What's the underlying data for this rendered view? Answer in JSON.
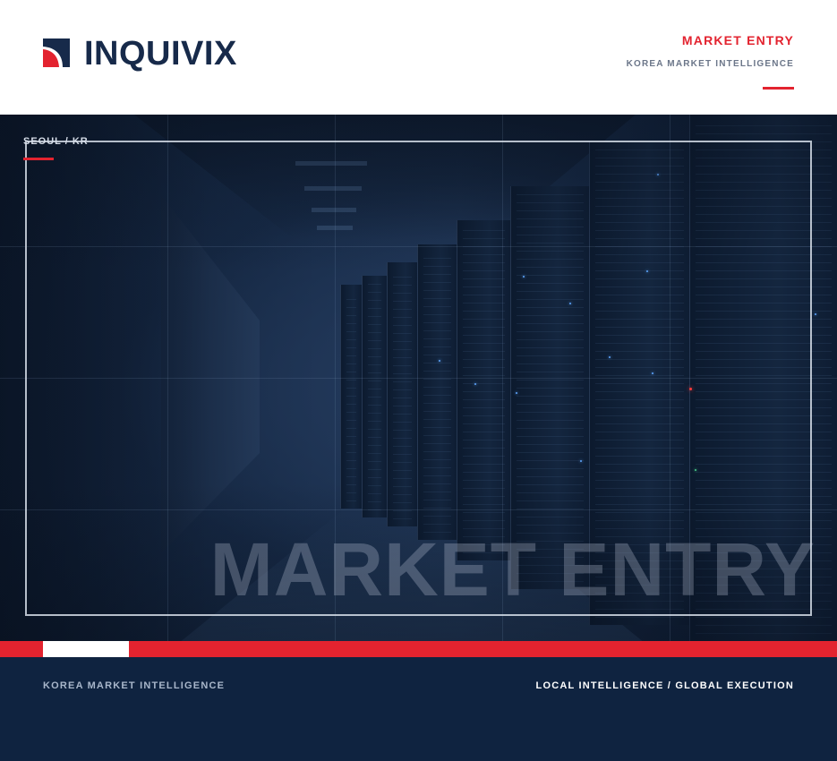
{
  "header": {
    "logo_text": "INQUIVIX",
    "title": "MARKET ENTRY",
    "subtitle": "KOREA MARKET INTELLIGENCE"
  },
  "hero": {
    "location_tag": "SEOUL / KR",
    "watermark": "MARKET ENTRY",
    "image": "server-room-photo"
  },
  "footer": {
    "left_text": "KOREA MARKET INTELLIGENCE",
    "right_text": "LOCAL INTELLIGENCE / GLOBAL EXECUTION"
  },
  "colors": {
    "accent": "#e3232f",
    "navy": "#172a4a",
    "footer_bg": "#0f2340"
  }
}
